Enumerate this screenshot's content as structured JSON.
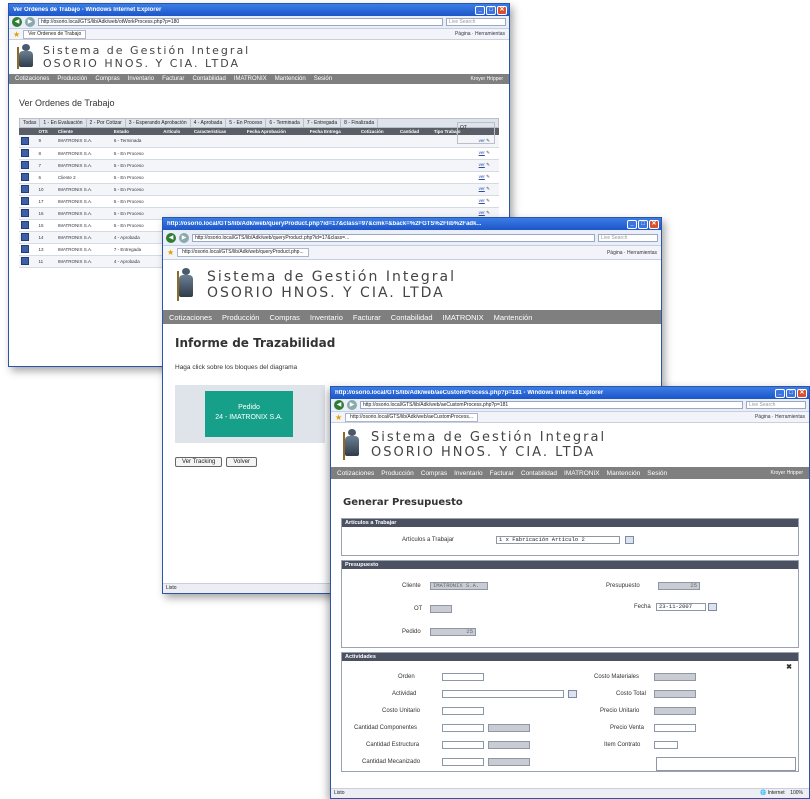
{
  "w1": {
    "title": "Ver Ordenes de Trabajo - Windows Internet Explorer",
    "address": "http://osorio.local/GTS/lib/Adk/web/otWorkProcess.php?p=180",
    "search_placeholder": "Live Search",
    "tab": "Ver Ordenes de Trabajo",
    "tools": "Página · Herramientas",
    "logo_line1": "Sistema de Gestión Integral",
    "logo_line2": "OSORIO HNOS. Y CIA. LTDA",
    "menu": [
      "Cotizaciones",
      "Producción",
      "Compras",
      "Inventario",
      "Facturar",
      "Contabilidad",
      "IMATRONIX",
      "Mantención",
      "Sesión"
    ],
    "menu_right": "Kroyer Hripper",
    "page_title": "Ver Ordenes de Trabajo",
    "filter_label": "OT",
    "tabs": [
      "Todas",
      "1 - En Evaluación",
      "2 - Por Cotizar",
      "3 - Esperando Aprobación",
      "4 - Aprobada",
      "5 - En Proceso",
      "6 - Terminada",
      "7 - Entregada",
      "8 - Finalizada"
    ],
    "headers": [
      "OTS",
      "Cliente",
      "Estado",
      "Artículo",
      "Características",
      "Fecha Aprobación",
      "Fecha Entrega",
      "Cotización",
      "Cantidad",
      "Tipo Trabajo"
    ],
    "rows": [
      {
        "n": "9",
        "cliente": "IMATRONIX S.A.",
        "estado": "6 - Terminada"
      },
      {
        "n": "8",
        "cliente": "IMATRONIX S.A.",
        "estado": "5 - En Proceso"
      },
      {
        "n": "7",
        "cliente": "IMATRONIX S.A.",
        "estado": "5 - En Proceso"
      },
      {
        "n": "6",
        "cliente": "Cliente 2",
        "estado": "5 - En Proceso"
      },
      {
        "n": "10",
        "cliente": "IMATRONIX S.A.",
        "estado": "5 - En Proceso"
      },
      {
        "n": "17",
        "cliente": "IMATRONIX S.A.",
        "estado": "5 - En Proceso"
      },
      {
        "n": "16",
        "cliente": "IMATRONIX S.A.",
        "estado": "5 - En Proceso"
      },
      {
        "n": "15",
        "cliente": "IMATRONIX S.A.",
        "estado": "5 - En Proceso"
      },
      {
        "n": "14",
        "cliente": "IMATRONIX S.A.",
        "estado": "4 - Aprobada"
      },
      {
        "n": "13",
        "cliente": "IMATRONIX S.A.",
        "estado": "7 - Entregada"
      },
      {
        "n": "11",
        "cliente": "IMATRONIX S.A.",
        "estado": "4 - Aprobada"
      }
    ],
    "ver_label": "ver"
  },
  "w2": {
    "title": "http://osorio.local/GTS/lib/Adk/web/queryProduct.php?id=17&class=97&cmk=&back=%2FGTS%2Flib%2Fadk...",
    "address": "http://osorio.local/GTS/lib/Adk/web/queryProduct.php?id=17&class=...",
    "search_placeholder": "Live Search",
    "tab": "http://osorio.local/GTS/lib/Adk/web/queryProduct.php...",
    "tools": "Página · Herramientas",
    "logo_line1": "Sistema de Gestión Integral",
    "logo_line2": "OSORIO HNOS. Y CIA. LTDA",
    "menu": [
      "Cotizaciones",
      "Producción",
      "Compras",
      "Inventario",
      "Facturar",
      "Contabilidad",
      "IMATRONIX",
      "Mantención"
    ],
    "page_title": "Informe de Trazabilidad",
    "hint": "Haga click sobre los bloques del diagrama",
    "node_line1": "Pedido",
    "node_line2": "24 - IMATRONIX S.A.",
    "btn_tracking": "Ver Tracking",
    "btn_volver": "Volver",
    "status": "Listo"
  },
  "w3": {
    "title": "http://osorio.local/GTS/lib/Adk/web/aeCustomProcess.php?p=181 - Windows Internet Explorer",
    "address": "http://osorio.local/GTS/lib/Adk/web/aeCustomProcess.php?p=181",
    "search_placeholder": "Live Search",
    "tab": "http://osorio.local/GTS/lib/Adk/web/aeCustomProcess...",
    "tools": "Página · Herramientas",
    "logo_line1": "Sistema de Gestión Integral",
    "logo_line2": "OSORIO HNOS. Y CIA. LTDA",
    "menu": [
      "Cotizaciones",
      "Producción",
      "Compras",
      "Inventario",
      "Facturar",
      "Contabilidad",
      "IMATRONIX",
      "Mantención",
      "Sesión"
    ],
    "menu_right": "Kroyer Hripper",
    "page_title": "Generar Presupuesto",
    "sec1": "Artículos a Trabajar",
    "articulos_label": "Artículos a Trabajar",
    "articulos_value": "1 x Fabricación Artículo 2",
    "sec2": "Presupuesto",
    "cliente_label": "Cliente",
    "cliente_value": "IMATRONIX S.A.",
    "presupuesto_label": "Presupuesto",
    "presupuesto_value": "25",
    "ot_label": "OT",
    "fecha_label": "Fecha",
    "fecha_value": "23-11-2007",
    "pedido_label": "Pedido",
    "pedido_value": "25",
    "sec3": "Actividades",
    "orden_label": "Orden",
    "actividad_label": "Actividad",
    "costo_unitario_label": "Costo Unitario",
    "cant_componentes_label": "Cantidad Componentes",
    "cant_estructura_label": "Cantidad Estructura",
    "cant_mecanizado_label": "Cantidad Mecanizado",
    "costo_materiales_label": "Costo Materiales",
    "costo_total_label": "Costo Total",
    "precio_unitario_label": "Precio Unitario",
    "precio_venta_label": "Precio Venta",
    "item_contrato_label": "Item Contrato",
    "status_left": "Listo",
    "status_internet": "Internet",
    "zoom": "100%"
  }
}
